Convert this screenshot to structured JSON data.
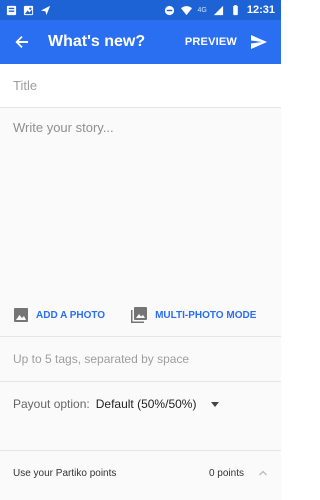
{
  "status_bar": {
    "time": "12:31",
    "network": "4G",
    "icons": [
      "notification-icon",
      "image-notification-icon",
      "send-notification-icon",
      "do-not-disturb-icon",
      "wifi-icon",
      "signal-icon",
      "battery-icon"
    ]
  },
  "app_bar": {
    "title": "What's new?",
    "preview_label": "PREVIEW",
    "back_icon": "back-arrow-icon",
    "send_icon": "send-icon",
    "accent": "#2a6ef2"
  },
  "form": {
    "title_placeholder": "Title",
    "story_placeholder": "Write your story...",
    "add_photo_label": "ADD A PHOTO",
    "multi_photo_label": "MULTI-PHOTO MODE",
    "tags_placeholder": "Up to 5 tags, separated by space",
    "payout_label": "Payout option:",
    "payout_value": "Default (50%/50%)",
    "points_label": "Use your Partiko points",
    "points_value": "0 points"
  }
}
